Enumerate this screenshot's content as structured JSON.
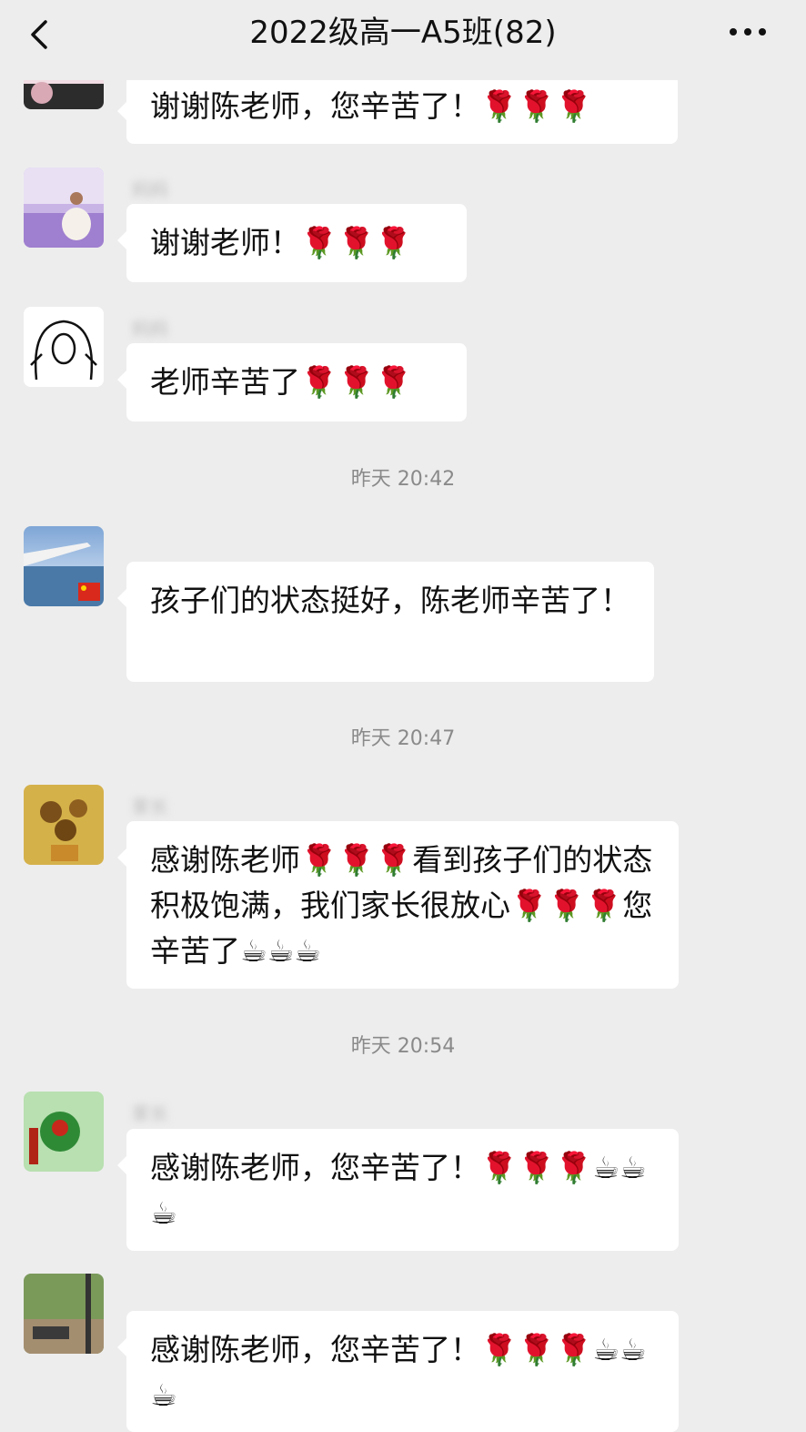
{
  "header": {
    "title": "2022级高一A5班(82)",
    "back_icon": "chevron-left-icon",
    "more_icon": "more-dots-icon"
  },
  "messages": [
    {
      "name": "",
      "text": "谢谢陈老师，您辛苦了！🌹🌹🌹"
    },
    {
      "name": "妈妈",
      "text": "谢谢老师！🌹🌹🌹"
    },
    {
      "name": "妈妈",
      "text": "老师辛苦了🌹🌹🌹"
    },
    {
      "name": "",
      "text": "孩子们的状态挺好，陈老师辛苦了！"
    },
    {
      "name": "家长",
      "text": "感谢陈老师🌹🌹🌹看到孩子们的状态积极饱满，我们家长很放心🌹🌹🌹您辛苦了☕☕☕"
    },
    {
      "name": "家长",
      "text": "感谢陈老师，您辛苦了！🌹🌹🌹☕☕☕"
    },
    {
      "name": "",
      "text": "感谢陈老师，您辛苦了！🌹🌹🌹☕☕☕"
    }
  ],
  "times": [
    "昨天 20:42",
    "昨天 20:47",
    "昨天 20:54"
  ]
}
